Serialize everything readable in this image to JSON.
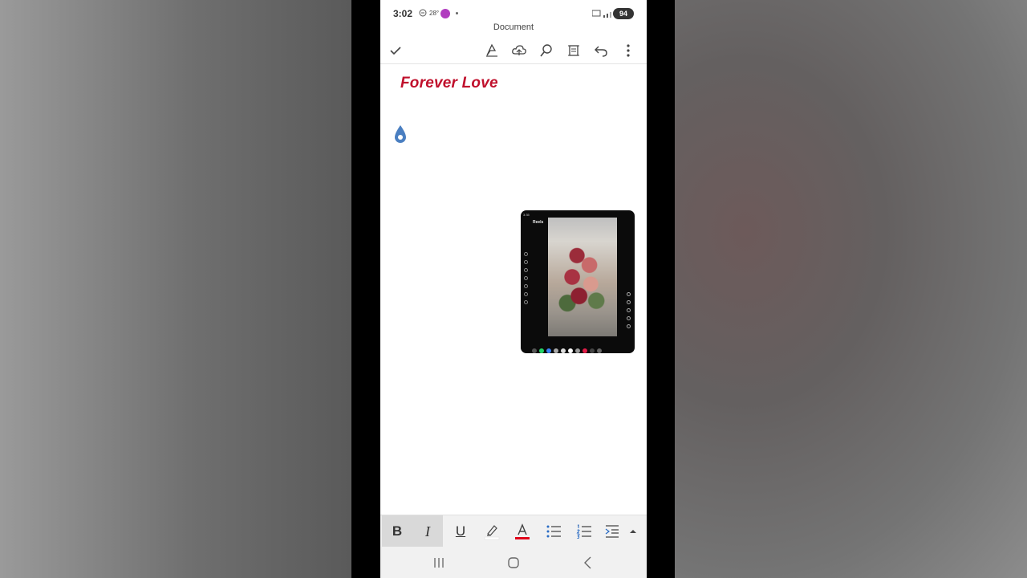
{
  "status_bar": {
    "time": "3:02",
    "temperature": "28°",
    "battery": "94"
  },
  "document": {
    "window_title": "Document",
    "heading": "Forever Love",
    "heading_color": "#c0102c"
  },
  "embedded_image": {
    "status_time": "3:35",
    "reels_label": "Reels"
  },
  "toolbar": {
    "icons": [
      "check-icon",
      "draw-pen-icon",
      "cloud-save-icon",
      "search-icon",
      "read-mode-icon",
      "undo-icon",
      "more-options-icon"
    ]
  },
  "format_bar": {
    "bold_label": "B",
    "italic_label": "I",
    "underline_label": "U",
    "highlight_color": "#ffffff",
    "font_color": "#e0001a",
    "icons": [
      "bullet-list-icon",
      "numbered-list-icon",
      "indent-icon",
      "expand-up-icon"
    ]
  },
  "nav_bar": {
    "icons": [
      "recent-apps-icon",
      "home-icon",
      "back-icon"
    ]
  }
}
